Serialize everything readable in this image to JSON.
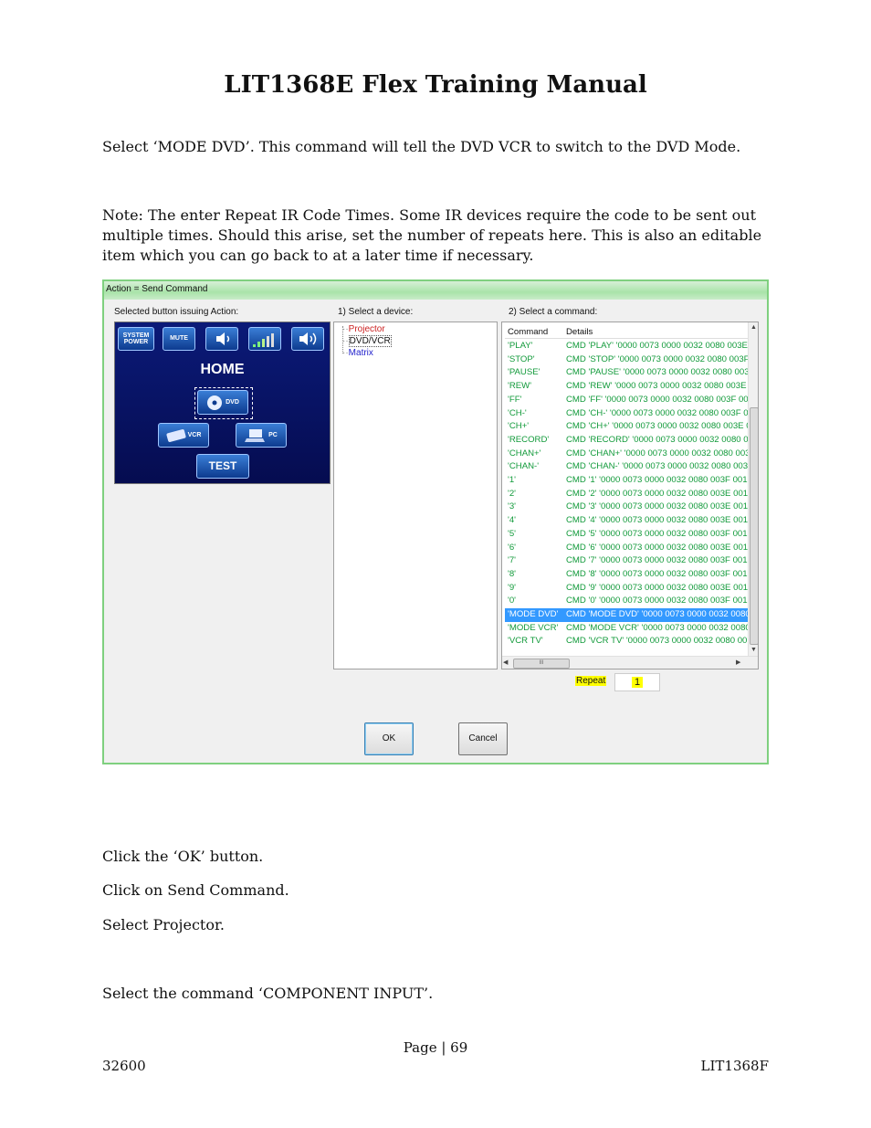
{
  "doc_title": "LIT1368E Flex Training Manual",
  "para1": "Select ‘MODE DVD’. This command will tell the DVD VCR to switch to the DVD Mode.",
  "para2": "Note: The enter Repeat IR Code Times. Some IR devices require the code to be sent out multiple times. Should this arise, set the number of repeats here. This is also an editable item which you can go back to at a later time if necessary.",
  "dialog": {
    "title": "Action = Send Command",
    "selected_button_label": "Selected button issuing Action:",
    "select_device_label": "1) Select a device:",
    "select_command_label": "2) Select a command:",
    "remote": {
      "buttons": [
        "SYSTEM POWER",
        "MUTE"
      ],
      "home_label": "HOME",
      "dvd_label": "DVD",
      "vcr_label": "VCR",
      "pc_label": "PC",
      "test_label": "TEST"
    },
    "devices": [
      "Projector",
      "DVD/VCR",
      "Matrix"
    ],
    "device_colors": {
      "projector": "#cc2222",
      "dvdvcr": "#111111",
      "matrix": "#2222cc"
    },
    "list_header": {
      "command": "Command",
      "details": "Details"
    },
    "commands": [
      {
        "cmd": "'PLAY'",
        "details": "CMD 'PLAY' '0000 0073 0000 0032 0080 003E"
      },
      {
        "cmd": "'STOP'",
        "details": "CMD 'STOP' '0000 0073 0000 0032 0080 003F"
      },
      {
        "cmd": "'PAUSE'",
        "details": "CMD 'PAUSE' '0000 0073 0000 0032 0080 003"
      },
      {
        "cmd": "'REW'",
        "details": "CMD 'REW' '0000 0073 0000 0032 0080 003E"
      },
      {
        "cmd": "'FF'",
        "details": "CMD 'FF' '0000 0073 0000 0032 0080 003F 001"
      },
      {
        "cmd": "'CH-'",
        "details": "CMD 'CH-' '0000 0073 0000 0032 0080 003F 00"
      },
      {
        "cmd": "'CH+'",
        "details": "CMD 'CH+' '0000 0073 0000 0032 0080 003E 0"
      },
      {
        "cmd": "'RECORD'",
        "details": "CMD 'RECORD' '0000 0073 0000 0032 0080 00"
      },
      {
        "cmd": "'CHAN+'",
        "details": "CMD 'CHAN+' '0000 0073 0000 0032 0080 003"
      },
      {
        "cmd": "'CHAN-'",
        "details": "CMD 'CHAN-' '0000 0073 0000 0032 0080 003F"
      },
      {
        "cmd": "'1'",
        "details": "CMD '1' '0000 0073 0000 0032 0080 003F 0010"
      },
      {
        "cmd": "'2'",
        "details": "CMD '2' '0000 0073 0000 0032 0080 003E 0010"
      },
      {
        "cmd": "'3'",
        "details": "CMD '3' '0000 0073 0000 0032 0080 003E 0010"
      },
      {
        "cmd": "'4'",
        "details": "CMD '4' '0000 0073 0000 0032 0080 003E 0010"
      },
      {
        "cmd": "'5'",
        "details": "CMD '5' '0000 0073 0000 0032 0080 003F 0010"
      },
      {
        "cmd": "'6'",
        "details": "CMD '6' '0000 0073 0000 0032 0080 003E 0010"
      },
      {
        "cmd": "'7'",
        "details": "CMD '7' '0000 0073 0000 0032 0080 003F 0010"
      },
      {
        "cmd": "'8'",
        "details": "CMD '8' '0000 0073 0000 0032 0080 003F 0010"
      },
      {
        "cmd": "'9'",
        "details": "CMD '9' '0000 0073 0000 0032 0080 003E 0010"
      },
      {
        "cmd": "'0'",
        "details": "CMD '0' '0000 0073 0000 0032 0080 003F 0010"
      },
      {
        "cmd": "'MODE DVD'",
        "details": "CMD 'MODE DVD' '0000 0073 0000 0032 0080"
      },
      {
        "cmd": "'MODE VCR'",
        "details": "CMD 'MODE VCR' '0000 0073 0000 0032 0080"
      },
      {
        "cmd": "'VCR TV'",
        "details": "CMD 'VCR TV' '0000 0073 0000 0032 0080 00"
      }
    ],
    "selected_index": 20,
    "hscroll_label": "III",
    "repeat_label": "Repeat",
    "repeat_value": "1",
    "ok_label": "OK",
    "cancel_label": "Cancel"
  },
  "steps": [
    "Click the ‘OK’ button.",
    "Click on Send Command.",
    "Select Projector.",
    "Select the command ‘COMPONENT INPUT’."
  ],
  "footer": {
    "page": "Page | 69",
    "left": "32600",
    "right": "LIT1368F"
  }
}
